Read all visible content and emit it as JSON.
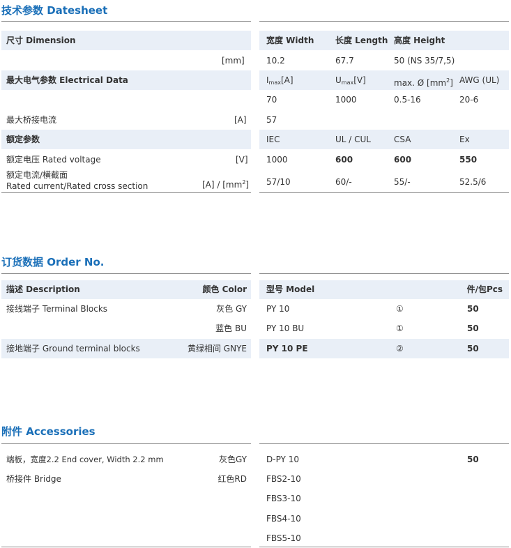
{
  "colors": {
    "accent": "#1a6fb8",
    "row_shade": "#e9eff7",
    "rule": "#888888",
    "text": "#333333"
  },
  "tech": {
    "title": "技术参数 Datesheet",
    "left": {
      "dimension": "尺寸 Dimension",
      "mm_unit": "[mm]",
      "electrical": "最大电气参数 Electrical Data",
      "bridge_current": "最大桥接电流",
      "bridge_unit": "[A]",
      "rated_params": "额定参数",
      "rated_voltage": "额定电压 Rated voltage",
      "voltage_unit": "[V]",
      "rated_current_cn": "额定电流/横截面",
      "rated_current_en": "Rated current/Rated cross section",
      "current_unit_prefix": "[A] / [mm",
      "current_unit_sup": "2",
      "current_unit_suffix": "]"
    },
    "right": {
      "width_h": "宽度 Width",
      "length_h": "长度 Length",
      "height_h": "高度 Height",
      "width_v": "10.2",
      "length_v": "67.7",
      "height_v": "50 (NS 35/7,5)",
      "imax_main": "I",
      "imax_sub": "max",
      "imax_unit": "[A]",
      "umax_main": "U",
      "umax_sub": "max",
      "umax_unit": "[V]",
      "maxd_pre": "max. Ø [mm",
      "maxd_sup": "2",
      "maxd_post": "]",
      "awg_h": "AWG (UL)",
      "imax_v": "70",
      "umax_v": "1000",
      "maxd_v": "0.5-16",
      "awg_v": "20-6",
      "bridge_v": "57",
      "iec_h": "IEC",
      "ul_h": "UL / CUL",
      "csa_h": "CSA",
      "ex_h": "Ex",
      "rv_iec": "1000",
      "rv_ul": "600",
      "rv_csa": "600",
      "rv_ex": "550",
      "rc_iec": "57/10",
      "rc_ul": "60/-",
      "rc_csa": "55/-",
      "rc_ex": "52.5/6"
    }
  },
  "order": {
    "title": "订货数据 Order No.",
    "desc_h": "描述 Description",
    "color_h": "颜色 Color",
    "model_h": "型号 Model",
    "pcs_h": "件/包Pcs",
    "rows": [
      {
        "desc": "接线端子 Terminal Blocks",
        "color": "灰色 GY",
        "model": "PY 10",
        "mark": "①",
        "pcs": "50"
      },
      {
        "desc": "",
        "color": "蓝色 BU",
        "model": "PY 10 BU",
        "mark": "①",
        "pcs": "50"
      },
      {
        "desc": "接地端子 Ground terminal blocks",
        "color": "黄绿相间 GNYE",
        "model": "PY 10 PE",
        "mark": "②",
        "pcs": "50"
      }
    ]
  },
  "acc": {
    "title": "附件 Accessories",
    "endcover": "端板，宽度2.2 End cover, Width 2.2 mm",
    "endcover_color": "灰色GY",
    "bridge": "桥接件 Bridge",
    "bridge_color": "红色RD",
    "models": [
      "D-PY 10",
      "FBS2-10",
      "FBS3-10",
      "FBS4-10",
      "FBS5-10"
    ],
    "pcs": "50"
  }
}
